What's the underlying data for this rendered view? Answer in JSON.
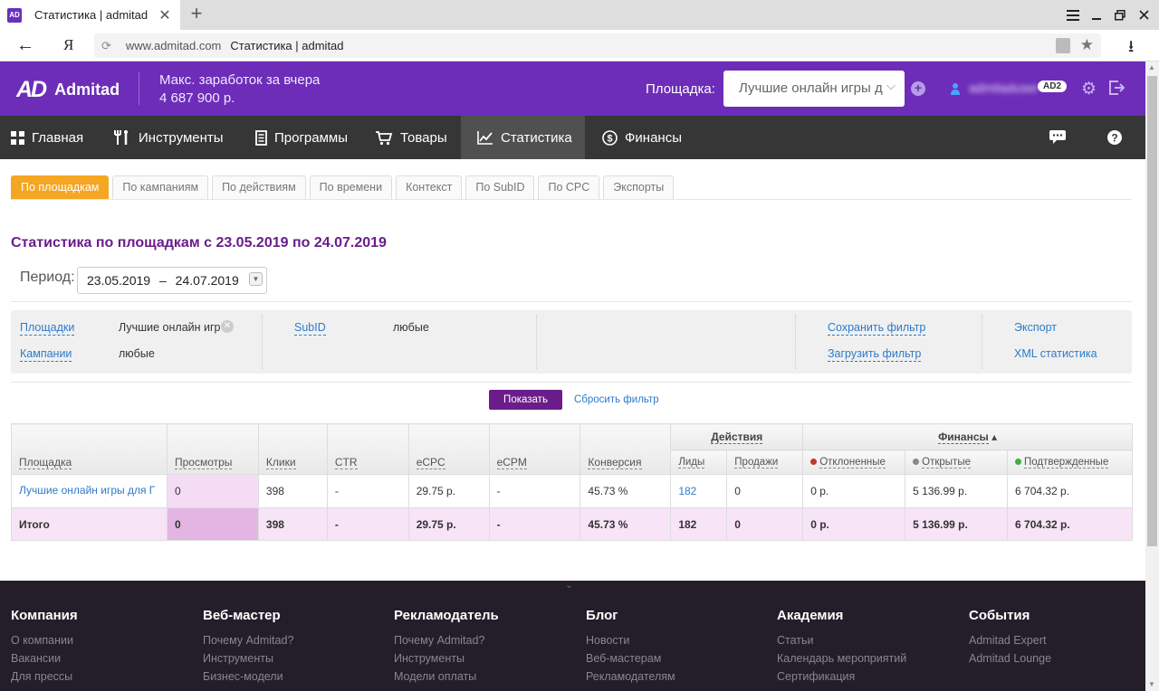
{
  "browser": {
    "tab_title": "Статистика | admitad",
    "tab_favicon": "AD",
    "url_domain": "www.admitad.com",
    "url_title": "Статистика | admitad",
    "yandex_label": "Я"
  },
  "header": {
    "logo_mark": "AD",
    "logo_text": "Admitad",
    "max_earn_label": "Макс. заработок за вчера",
    "max_earn_value": "4 687 900 р.",
    "platform_label": "Площадка:",
    "platform_value": "Лучшие онлайн игры д",
    "username": "admitaduser",
    "badge": "AD2",
    "colors": {
      "brand": "#6d2db8",
      "nav": "#363636"
    }
  },
  "nav": {
    "items": [
      {
        "label": "Главная",
        "icon": "grid-icon"
      },
      {
        "label": "Инструменты",
        "icon": "tools-icon"
      },
      {
        "label": "Программы",
        "icon": "document-icon"
      },
      {
        "label": "Товары",
        "icon": "cart-icon"
      },
      {
        "label": "Статистика",
        "icon": "chart-icon"
      },
      {
        "label": "Финансы",
        "icon": "dollar-icon"
      }
    ],
    "active": "Статистика"
  },
  "tabs": [
    "По площадкам",
    "По кампаниям",
    "По действиям",
    "По времени",
    "Контекст",
    "По SubID",
    "По CPC",
    "Экспорты"
  ],
  "page": {
    "title": "Статистика по площадкам с 23.05.2019 по 24.07.2019",
    "period_label": "Период:",
    "period_from": "23.05.2019",
    "period_dash": "–",
    "period_to": "24.07.2019"
  },
  "filters": {
    "platforms_label": "Площадки",
    "platforms_value": "Лучшие онлайн игр",
    "campaigns_label": "Кампании",
    "campaigns_value": "любые",
    "subid_label": "SubID",
    "subid_value": "любые",
    "save_filter": "Сохранить фильтр",
    "load_filter": "Загрузить фильтр",
    "export": "Экспорт",
    "xml_stats": "XML статистика"
  },
  "actions": {
    "show": "Показать",
    "reset": "Сбросить фильтр"
  },
  "table": {
    "headers": {
      "platform": "Площадка",
      "views": "Просмотры",
      "clicks": "Клики",
      "ctr": "CTR",
      "ecpc": "eCPC",
      "ecpm": "eCPM",
      "conversion": "Конверсия",
      "actions_group": "Действия",
      "leads": "Лиды",
      "sales": "Продажи",
      "finance_group": "Финансы",
      "rejected": "Отклоненные",
      "open": "Открытые",
      "confirmed": "Подтвержденные"
    },
    "status_colors": {
      "rejected": "#c0392b",
      "open": "#888888",
      "confirmed": "#3cb043"
    },
    "rows": [
      {
        "platform": "Лучшие онлайн игры для ПК",
        "views": "0",
        "clicks": "398",
        "ctr": "-",
        "ecpc": "29.75 р.",
        "ecpm": "-",
        "conversion": "45.73 %",
        "leads": "182",
        "sales": "0",
        "rejected": "0 р.",
        "open": "5 136.99 р.",
        "confirmed": "6 704.32 р."
      }
    ],
    "total": {
      "label": "Итого",
      "views": "0",
      "clicks": "398",
      "ctr": "-",
      "ecpc": "29.75 р.",
      "ecpm": "-",
      "conversion": "45.73 %",
      "leads": "182",
      "sales": "0",
      "rejected": "0 р.",
      "open": "5 136.99 р.",
      "confirmed": "6 704.32 р."
    }
  },
  "footer": {
    "columns": [
      {
        "title": "Компания",
        "links": [
          "О компании",
          "Вакансии",
          "Для прессы"
        ]
      },
      {
        "title": "Веб-мастер",
        "links": [
          "Почему Admitad?",
          "Инструменты",
          "Бизнес-модели"
        ]
      },
      {
        "title": "Рекламодатель",
        "links": [
          "Почему Admitad?",
          "Инструменты",
          "Модели оплаты"
        ]
      },
      {
        "title": "Блог",
        "links": [
          "Новости",
          "Веб-мастерам",
          "Рекламодателям"
        ]
      },
      {
        "title": "Академия",
        "links": [
          "Статьи",
          "Календарь мероприятий",
          "Сертификация"
        ]
      },
      {
        "title": "События",
        "links": [
          "Admitad Expert",
          "Admitad Lounge"
        ]
      }
    ]
  }
}
